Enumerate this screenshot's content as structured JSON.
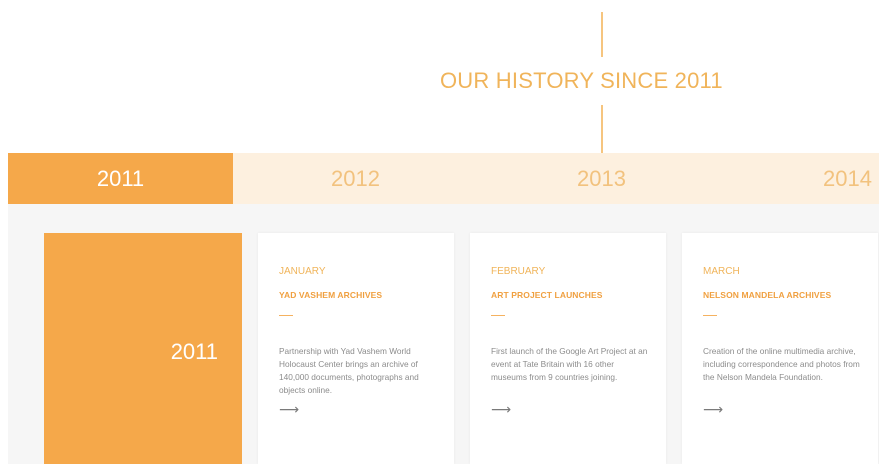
{
  "header": {
    "title": "OUR HISTORY SINCE 2011"
  },
  "years": [
    {
      "label": "2011",
      "active": true
    },
    {
      "label": "2012",
      "active": false
    },
    {
      "label": "2013",
      "active": false
    },
    {
      "label": "2014",
      "active": false
    }
  ],
  "selected_year": "2011",
  "cards": [
    {
      "month": "JANUARY",
      "title": "YAD VASHEM ARCHIVES",
      "description": "Partnership with Yad Vashem World Holocaust Center brings an archive of 140,000 documents, photographs and objects online.",
      "arrow": "⟶"
    },
    {
      "month": "FEBRUARY",
      "title": "ART PROJECT LAUNCHES",
      "description": "First launch of the Google Art Project at an event at Tate Britain with 16 other museums from 9 countries joining.",
      "arrow": "⟶"
    },
    {
      "month": "MARCH",
      "title": "NELSON MANDELA ARCHIVES",
      "description": "Creation of the online multimedia archive, including correspondence and photos from the Nelson Mandela Foundation.",
      "arrow": "⟶"
    }
  ],
  "colors": {
    "accent": "#f5a84a",
    "accent_light": "#fdf0df",
    "text_accent": "#f0b45a",
    "background_gray": "#f6f6f6"
  }
}
